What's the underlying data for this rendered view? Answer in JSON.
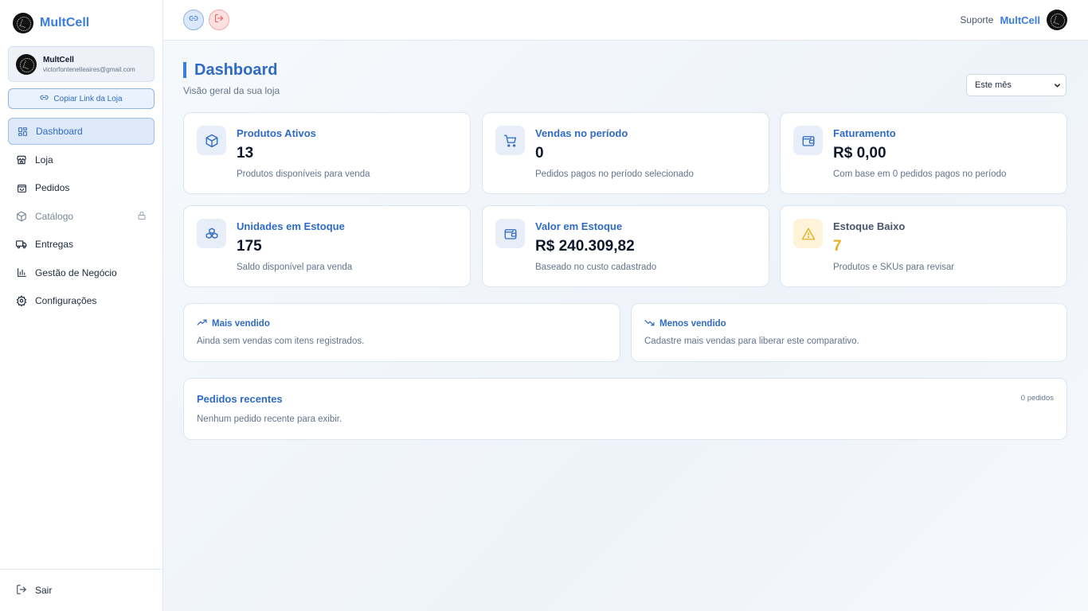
{
  "brand": {
    "name": "MultCell"
  },
  "user": {
    "name": "MultCell",
    "email": "victorfontenelleaires@gmail.com"
  },
  "sidebar": {
    "copy_link_label": "Copiar Link da Loja",
    "items": [
      {
        "label": "Dashboard",
        "icon": "dashboard-icon",
        "active": true
      },
      {
        "label": "Loja",
        "icon": "store-icon"
      },
      {
        "label": "Pedidos",
        "icon": "bag-icon"
      },
      {
        "label": "Catálogo",
        "icon": "box-icon",
        "locked": true
      },
      {
        "label": "Entregas",
        "icon": "truck-icon"
      },
      {
        "label": "Gestão de Negócio",
        "icon": "bar-chart-icon"
      },
      {
        "label": "Configurações",
        "icon": "gear-icon"
      }
    ],
    "logout_label": "Sair"
  },
  "topbar": {
    "support_label": "Suporte",
    "brand_name": "MultCell"
  },
  "page": {
    "title": "Dashboard",
    "subtitle": "Visão geral da sua loja",
    "period": {
      "selected": "Este mês"
    }
  },
  "stats": [
    {
      "label": "Produtos Ativos",
      "value": "13",
      "desc": "Produtos disponíveis para venda",
      "icon": "package-icon"
    },
    {
      "label": "Vendas no período",
      "value": "0",
      "desc": "Pedidos pagos no período selecionado",
      "icon": "cart-icon"
    },
    {
      "label": "Faturamento",
      "value": "R$ 0,00",
      "desc": "Com base em 0 pedidos pagos no período",
      "icon": "wallet-icon"
    },
    {
      "label": "Unidades em Estoque",
      "value": "175",
      "desc": "Saldo disponível para venda",
      "icon": "boxes-icon"
    },
    {
      "label": "Valor em Estoque",
      "value": "R$ 240.309,82",
      "desc": "Baseado no custo cadastrado",
      "icon": "wallet-icon"
    },
    {
      "label": "Estoque Baixo",
      "value": "7",
      "desc": "Produtos e SKUs para revisar",
      "icon": "warning-icon"
    }
  ],
  "insights": {
    "best": {
      "title": "Mais vendido",
      "desc": "Ainda sem vendas com itens registrados."
    },
    "worst": {
      "title": "Menos vendido",
      "desc": "Cadastre mais vendas para liberar este comparativo."
    }
  },
  "recent_orders": {
    "title": "Pedidos recentes",
    "count": "0 pedidos",
    "empty": "Nenhum pedido recente para exibir."
  },
  "colors": {
    "accent": "#3b7ddd",
    "warning": "#e5b020",
    "danger": "#f0a9a9"
  }
}
